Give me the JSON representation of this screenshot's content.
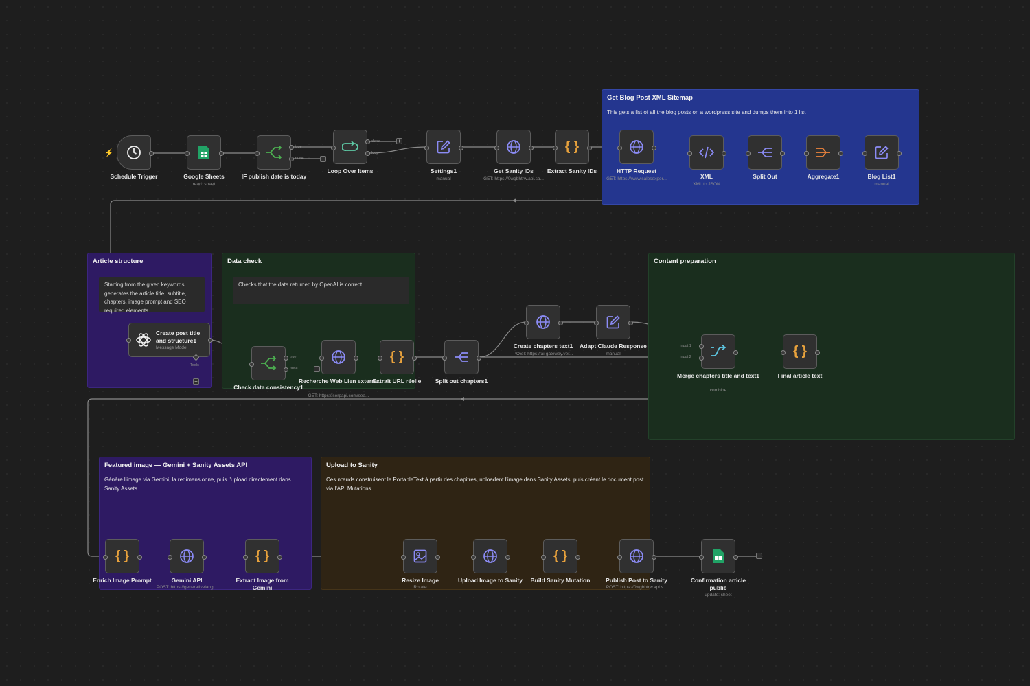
{
  "stickies": {
    "sitemap": {
      "title": "Get Blog Post XML Sitemap",
      "body": "This gets a list of all the blog posts on a wordpress site and dumps them into 1 list"
    },
    "article": {
      "title": "Article structure",
      "note": "Starting from the given keywords, generates the article title, subtitle, chapters, image prompt and SEO required elements."
    },
    "datacheck": {
      "title": "Data check",
      "note": "Checks that the data returned by OpenAI is correct"
    },
    "content": {
      "title": "Content preparation"
    },
    "featured": {
      "title": "Featured image — Gemini + Sanity Assets API",
      "body": "Génère l'image via Gemini, la redimensionne, puis l'upload directement dans Sanity Assets."
    },
    "upload": {
      "title": "Upload to Sanity",
      "body": "Ces nœuds construisent le PortableText à partir des chapitres, uploadent l'image dans Sanity Assets, puis créent le document post via l'API Mutations."
    }
  },
  "nodes": {
    "schedule": {
      "label": "Schedule Trigger",
      "icon": "clock-icon"
    },
    "sheets": {
      "label": "Google Sheets",
      "sub": "read: sheet",
      "icon": "sheets-icon"
    },
    "ifpublish": {
      "label": "IF publish date is today",
      "icon": "branch-icon",
      "true": "true",
      "false": "false"
    },
    "loop": {
      "label": "Loop Over Items",
      "icon": "loop-icon",
      "done": "done",
      "loop": "loop"
    },
    "settings": {
      "label": "Settings1",
      "sub": "manual",
      "icon": "edit-icon"
    },
    "getsanity": {
      "label": "Get Sanity IDs",
      "sub": "GET: https://0wgbhtrw.api.sa...",
      "icon": "globe-icon"
    },
    "extractsanity": {
      "label": "Extract Sanity IDs",
      "icon": "code-icon"
    },
    "http": {
      "label": "HTTP Request",
      "sub": "GET: https://www.salesexper...",
      "icon": "globe-icon"
    },
    "xml": {
      "label": "XML",
      "sub": "XML to JSON",
      "icon": "xml-icon"
    },
    "splitout": {
      "label": "Split Out",
      "icon": "split-icon"
    },
    "aggregate": {
      "label": "Aggregate1",
      "icon": "aggregate-icon"
    },
    "bloglist": {
      "label": "Blog List1",
      "sub": "manual",
      "icon": "edit-icon"
    },
    "createpost": {
      "label": "Create post title and structure1",
      "sub": "Message Model",
      "tools": "Tools",
      "icon": "openai-icon"
    },
    "checkdata": {
      "label": "Check data consistency1",
      "icon": "branch-icon",
      "true": "true",
      "false": "false"
    },
    "recherche": {
      "label": "Recherche Web Lien externe",
      "sub": "GET: https://serpapi.com/sea...",
      "icon": "globe-icon"
    },
    "extrait": {
      "label": "Extrait URL réelle",
      "icon": "code-icon"
    },
    "splitchapters": {
      "label": "Split out chapters1",
      "icon": "split-icon"
    },
    "createchapters": {
      "label": "Create chapters text1",
      "sub": "POST: https://ai-gateway.ver...",
      "icon": "globe-icon"
    },
    "adapt": {
      "label": "Adapt Claude Response",
      "sub": "manual",
      "icon": "edit-icon"
    },
    "merge": {
      "label": "Merge chapters title and text1",
      "sub": "combine",
      "icon": "merge-icon",
      "input1": "Input 1",
      "input2": "Input 2"
    },
    "finaltext": {
      "label": "Final article text",
      "icon": "code-icon"
    },
    "enrich": {
      "label": "Enrich Image Prompt",
      "icon": "code-icon"
    },
    "gemini": {
      "label": "Gemini API",
      "sub": "POST: https://generativelang...",
      "icon": "globe-icon"
    },
    "extractimg": {
      "label": "Extract Image from Gemini",
      "icon": "code-icon"
    },
    "resize": {
      "label": "Resize Image",
      "sub": "Rotate",
      "icon": "image-icon"
    },
    "uploadimg": {
      "label": "Upload Image to Sanity",
      "icon": "globe-icon"
    },
    "buildmut": {
      "label": "Build Sanity Mutation",
      "icon": "code-icon"
    },
    "publish": {
      "label": "Publish Post to Sanity",
      "sub": "POST: https://0wgbhtrw.api.s...",
      "icon": "globe-icon"
    },
    "confirm": {
      "label": "Confirmation article publié",
      "sub": "update: sheet",
      "icon": "sheets-icon"
    }
  },
  "colors": {
    "canvas": "#1e1e1e",
    "node": "#303030",
    "wire": "#8a8a8a",
    "blue_icon": "#8b8bf5",
    "green_icon": "#4caf50",
    "code_icon": "#e8a23d",
    "orange_icon": "#f0843c"
  }
}
